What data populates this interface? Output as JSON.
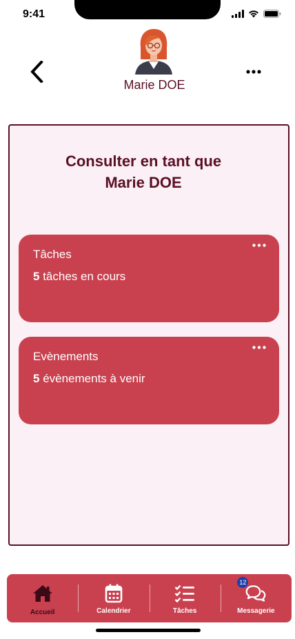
{
  "status_bar": {
    "time": "9:41",
    "icons": [
      "cellular-signal-icon",
      "wifi-icon",
      "battery-icon"
    ]
  },
  "header": {
    "back_icon": "chevron-left-icon",
    "more_icon": "more-horizontal-icon",
    "profile_name": "Marie DOE"
  },
  "panel": {
    "title_line1": "Consulter en tant que",
    "title_line2": "Marie DOE",
    "cards": [
      {
        "title": "Tâches",
        "count": "5",
        "desc": " tâches en cours"
      },
      {
        "title": "Evènements",
        "count": "5",
        "desc": " évènements à venir"
      }
    ]
  },
  "tab_bar": {
    "tabs": [
      {
        "label": "Accueil",
        "icon": "home-icon",
        "active": true
      },
      {
        "label": "Calendrier",
        "icon": "calendar-icon",
        "active": false
      },
      {
        "label": "Tâches",
        "icon": "checklist-icon",
        "active": false
      },
      {
        "label": "Messagerie",
        "icon": "chat-bubbles-icon",
        "active": false,
        "badge": "12"
      }
    ]
  },
  "colors": {
    "primary": "#c9414f",
    "dark": "#5a0f24",
    "panel_bg": "#fbf0f5",
    "badge": "#1f3fa8"
  }
}
